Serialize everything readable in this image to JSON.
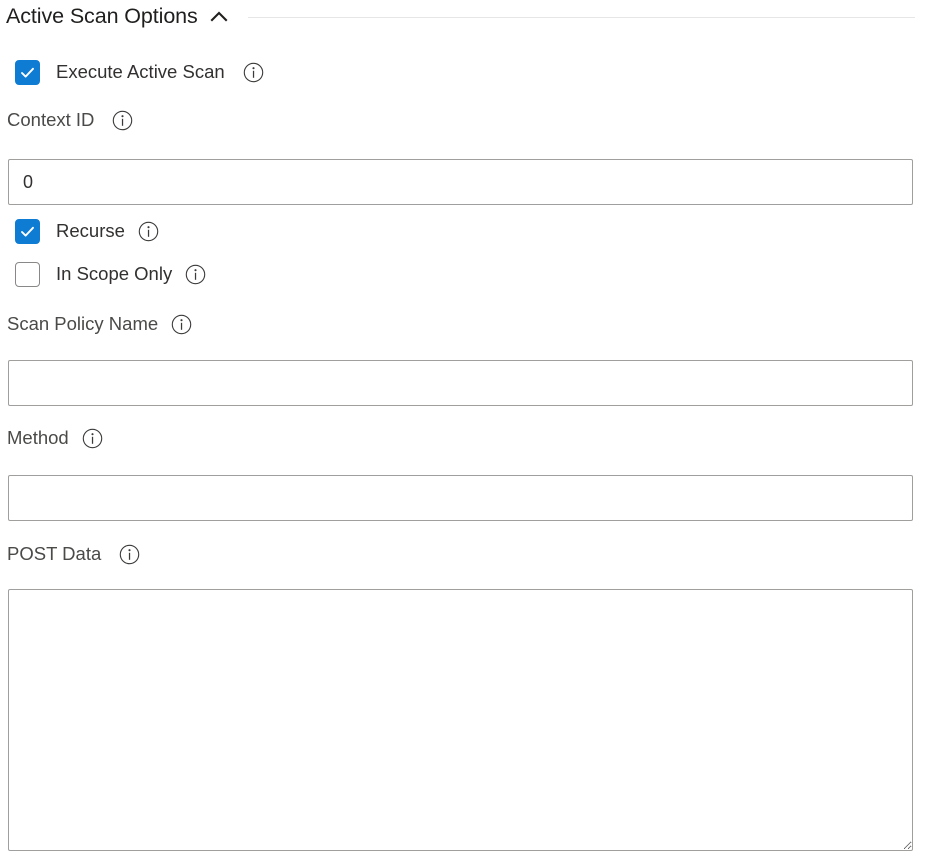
{
  "group": {
    "title": "Active Scan Options",
    "collapse_icon": "chevron-up-icon",
    "expanded": true
  },
  "fields": {
    "execute_active_scan": {
      "label": "Execute Active Scan",
      "checked": true,
      "info_icon": "info-icon"
    },
    "context_id": {
      "label": "Context ID",
      "value": "0",
      "placeholder": "",
      "info_icon": "info-icon"
    },
    "recurse": {
      "label": "Recurse",
      "checked": true,
      "info_icon": "info-icon"
    },
    "in_scope_only": {
      "label": "In Scope Only",
      "checked": false,
      "info_icon": "info-icon"
    },
    "scan_policy_name": {
      "label": "Scan Policy Name",
      "value": "",
      "placeholder": "",
      "info_icon": "info-icon"
    },
    "method": {
      "label": "Method",
      "value": "",
      "placeholder": "",
      "info_icon": "info-icon"
    },
    "post_data": {
      "label": "POST Data",
      "value": "",
      "placeholder": "",
      "info_icon": "info-icon"
    }
  },
  "colors": {
    "checkbox_accent": "#0f7cd4",
    "label_text": "#4a4a48",
    "title_text": "#201f1e",
    "input_border": "#a19f9d",
    "rule": "#e6e6e6",
    "background": "#ffffff"
  }
}
